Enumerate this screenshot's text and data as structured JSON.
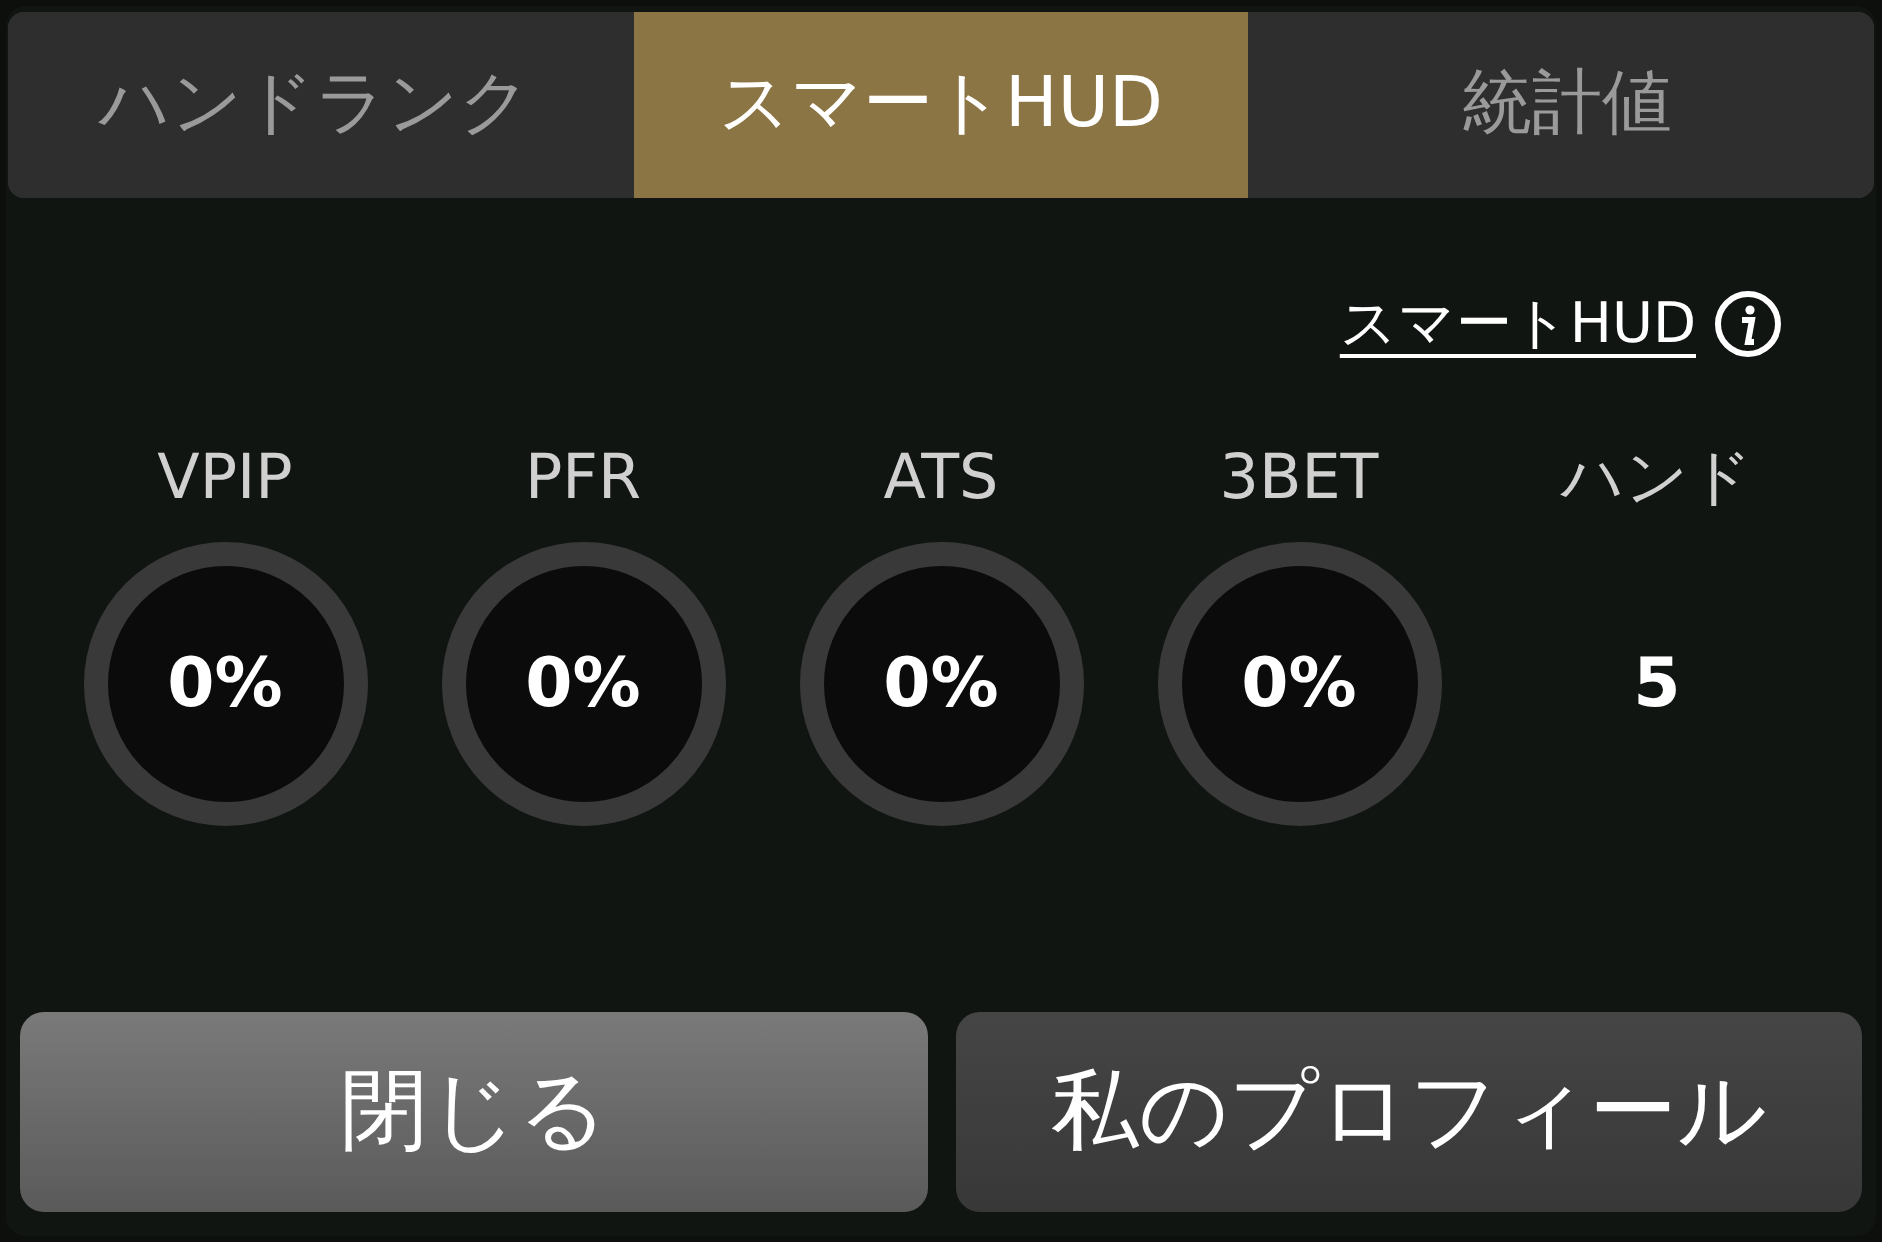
{
  "tabs": [
    {
      "label": "ハンドランク",
      "selected": false
    },
    {
      "label": "スマートHUD",
      "selected": true
    },
    {
      "label": "統計値",
      "selected": false
    }
  ],
  "help_link": {
    "label": "スマートHUD"
  },
  "stats": [
    {
      "kind": "ring",
      "label": "VPIP",
      "value": "0%"
    },
    {
      "kind": "ring",
      "label": "PFR",
      "value": "0%"
    },
    {
      "kind": "ring",
      "label": "ATS",
      "value": "0%"
    },
    {
      "kind": "ring",
      "label": "3BET",
      "value": "0%"
    },
    {
      "kind": "count",
      "label": "ハンド",
      "value": "5"
    }
  ],
  "buttons": [
    {
      "label": "閉じる",
      "kind": "primary"
    },
    {
      "label": "私のプロフィール",
      "kind": "secondary"
    }
  ]
}
